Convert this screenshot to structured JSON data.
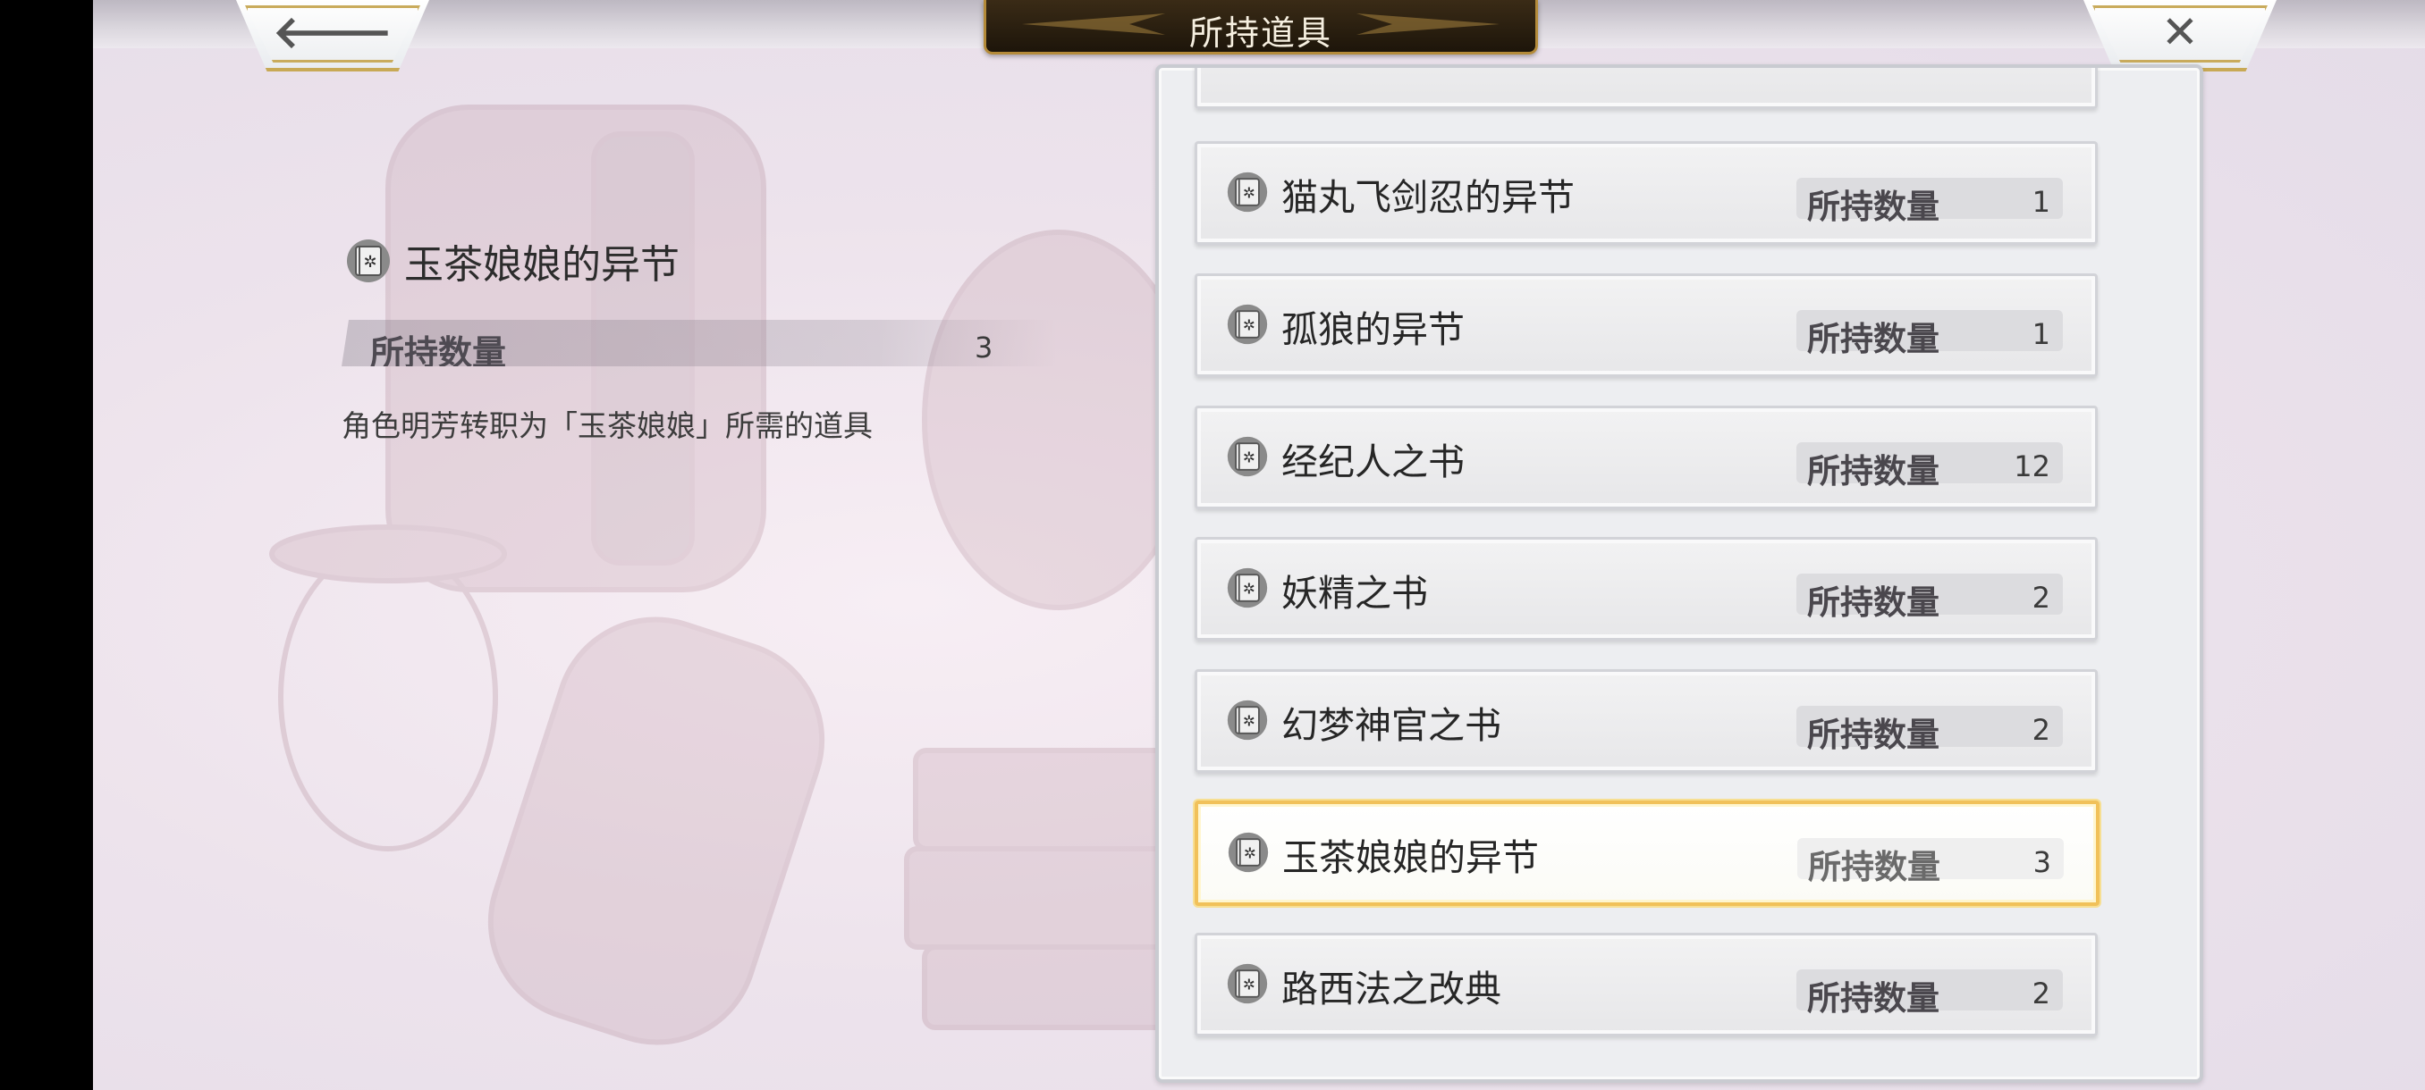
{
  "screen": {
    "title": "所持道具",
    "back_icon": "arrow-left-icon",
    "close_icon": "close-x-icon"
  },
  "detail": {
    "icon": "book-icon",
    "title": "玉茶娘娘的异节",
    "qty_label": "所持数量",
    "qty_value": "3",
    "description": "角色明芳转职为「玉茶娘娘」所需的道具"
  },
  "items": [
    {
      "name": "猫丸飞剑忍的异节",
      "qty_label": "所持数量",
      "qty": "1",
      "selected": false
    },
    {
      "name": "孤狼的异节",
      "qty_label": "所持数量",
      "qty": "1",
      "selected": false
    },
    {
      "name": "经纪人之书",
      "qty_label": "所持数量",
      "qty": "12",
      "selected": false
    },
    {
      "name": "妖精之书",
      "qty_label": "所持数量",
      "qty": "2",
      "selected": false
    },
    {
      "name": "幻梦神官之书",
      "qty_label": "所持数量",
      "qty": "2",
      "selected": false
    },
    {
      "name": "玉茶娘娘的异节",
      "qty_label": "所持数量",
      "qty": "3",
      "selected": true
    },
    {
      "name": "路西法之改典",
      "qty_label": "所持数量",
      "qty": "2",
      "selected": false
    }
  ],
  "colors": {
    "selected_border": "#f1c15a",
    "gold_trim": "#c8a955",
    "title_plate": "#2a1f10"
  }
}
